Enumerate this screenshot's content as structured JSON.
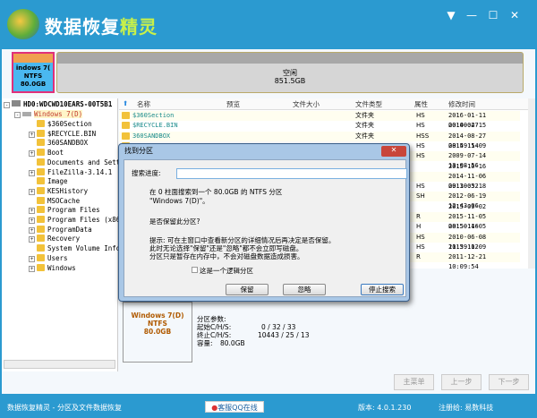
{
  "app": {
    "title_main": "数据恢复",
    "title_accent": "精灵"
  },
  "window_controls": [
    "▼",
    "—",
    "☐",
    "✕"
  ],
  "disk": {
    "partition": {
      "name": "indows 7(",
      "fs": "NTFS",
      "size": "80.0GB"
    },
    "free": {
      "label": "空闲",
      "size": "851.5GB"
    }
  },
  "tree": {
    "disk": "HD0:WDCWD10EARS-00T5B1",
    "partition": "Windows 7(D)",
    "folders": [
      {
        "name": "$360Section",
        "exp": false
      },
      {
        "name": "$RECYCLE.BIN",
        "exp": true
      },
      {
        "name": "360SANDBOX",
        "exp": false
      },
      {
        "name": "Boot",
        "exp": true
      },
      {
        "name": "Documents and Setti",
        "exp": false
      },
      {
        "name": "FileZilla-3.14.1",
        "exp": true
      },
      {
        "name": "Image",
        "exp": false
      },
      {
        "name": "KESHistory",
        "exp": true
      },
      {
        "name": "MSOCache",
        "exp": false
      },
      {
        "name": "Program Files",
        "exp": true
      },
      {
        "name": "Program Files (x86)",
        "exp": true
      },
      {
        "name": "ProgramData",
        "exp": true
      },
      {
        "name": "Recovery",
        "exp": true
      },
      {
        "name": "System Volume Infor",
        "exp": false
      },
      {
        "name": "Users",
        "exp": true
      },
      {
        "name": "Windows",
        "exp": true
      }
    ]
  },
  "list": {
    "headers": [
      "名称",
      "预览",
      "文件大小",
      "文件类型",
      "属性",
      "修改时间"
    ],
    "rows": [
      {
        "name": "$360Section",
        "type": "文件夹",
        "attr": "HS",
        "time": "2016-01-11 00:00:47"
      },
      {
        "name": "$RECYCLE.BIN",
        "type": "文件夹",
        "attr": "HS",
        "time": "2014-02-15 09:41:36"
      },
      {
        "name": "360SANDBOX",
        "type": "文件夹",
        "attr": "HSS",
        "time": "2014-08-27 08:49:54"
      },
      {
        "name": "",
        "type": "",
        "attr": "HS",
        "time": "2015-11-09 08:57:29"
      },
      {
        "name": "",
        "type": "",
        "attr": "HS",
        "time": "2009-07-14 13:08:56"
      },
      {
        "name": "",
        "type": "",
        "attr": "",
        "time": "2015-10-16 10:02:55"
      },
      {
        "name": "",
        "type": "",
        "attr": "",
        "time": "2014-11-06 09:30:52"
      },
      {
        "name": "",
        "type": "",
        "attr": "HS",
        "time": "2011-03-18 14:01:36"
      },
      {
        "name": "",
        "type": "",
        "attr": "SH",
        "time": "2012-06-19 12:43:06"
      },
      {
        "name": "",
        "type": "",
        "attr": "",
        "time": "2015-09-02 17:27:25"
      },
      {
        "name": "",
        "type": "",
        "attr": "R",
        "time": "2015-11-05 08:50:46"
      },
      {
        "name": "",
        "type": "",
        "attr": "H",
        "time": "2015-11-05 08:50:46"
      },
      {
        "name": "",
        "type": "",
        "attr": "HS",
        "time": "2010-06-08 11:39:02"
      },
      {
        "name": "",
        "type": "",
        "attr": "HS",
        "time": "2015-11-09 10:53:53"
      },
      {
        "name": "",
        "type": "",
        "attr": "R",
        "time": "2011-12-21 10:09:54"
      }
    ]
  },
  "dialog": {
    "title": "找到分区",
    "close": "✕",
    "progress_label": "搜索进度:",
    "msg1": "在 0 柱面搜索到一个 80.0GB 的 NTFS 分区",
    "msg2": "\"Windows 7(D)\"。",
    "question": "是否保留此分区?",
    "hint1": "提示: 可在主窗口中查看新分区的详细情况后再决定是否保留。",
    "hint2": "此时无论选择\"保留\"还是\"忽略\"都不会立即写磁盘。",
    "hint3": "分区只是暂存在内存中，不会对磁盘数据造成损害。",
    "checkbox": "这是一个逻辑分区",
    "keep": "保留",
    "ignore": "忽略",
    "stop": "停止搜索"
  },
  "info": {
    "name": "Windows 7(D)",
    "fs": "NTFS",
    "size": "80.0GB",
    "params_title": "分区参数:",
    "start_label": "起始C/H/S:",
    "start_val": "0 / 32 / 33",
    "end_label": "终止C/H/S:",
    "end_val": "10443 / 25 / 13",
    "cap_label": "容量:",
    "cap_val": "80.0GB"
  },
  "nav": {
    "main": "主菜单",
    "prev": "上一步",
    "next": "下一步"
  },
  "status": {
    "left": "数据恢复精灵 - 分区及文件数据恢复",
    "qq": "客服QQ在线",
    "version": "版本: 4.0.1.230",
    "reg": "注册给:  易数科技"
  }
}
